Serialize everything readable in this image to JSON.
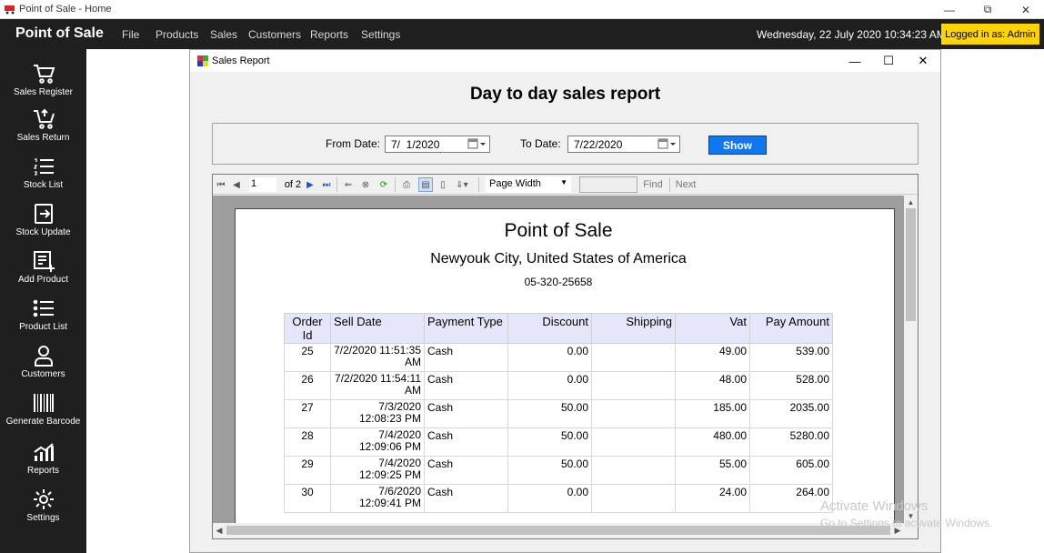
{
  "window": {
    "title": "Point of Sale - Home",
    "controls": {
      "minimize": "—",
      "restore": "⧉",
      "close": "✕"
    }
  },
  "menubar": {
    "brand": "Point of Sale",
    "items": [
      "File",
      "Products",
      "Sales",
      "Customers",
      "Reports",
      "Settings"
    ],
    "datetime": "Wednesday, 22 July 2020 10:34:23 AM",
    "login": "Logged in as: Admin"
  },
  "sidebar": {
    "items": [
      {
        "label": "Sales Register",
        "icon": "cart-icon"
      },
      {
        "label": "Sales Return",
        "icon": "cart-return-icon"
      },
      {
        "label": "Stock List",
        "icon": "numbered-list-icon"
      },
      {
        "label": "Stock Update",
        "icon": "exit-box-icon"
      },
      {
        "label": "Add Product",
        "icon": "add-document-icon"
      },
      {
        "label": "Product List",
        "icon": "bullet-list-icon"
      },
      {
        "label": "Customers",
        "icon": "person-icon"
      },
      {
        "label": "Generate Barcode",
        "icon": "barcode-icon"
      },
      {
        "label": "Reports",
        "icon": "chart-icon"
      },
      {
        "label": "Settings",
        "icon": "gear-icon"
      }
    ]
  },
  "sales_report": {
    "window_title": "Sales Report",
    "heading": "Day to day sales report",
    "from_label": "From Date:",
    "from_value": "7/  1/2020",
    "to_label": "To Date:",
    "to_value": "7/22/2020",
    "show_label": "Show"
  },
  "viewer": {
    "page_current": "1",
    "page_of": "of 2",
    "zoom": "Page Width",
    "find_label": "Find",
    "next_label": "Next"
  },
  "report": {
    "store_name": "Point of Sale",
    "address": "Newyouk City, United States of America",
    "phone": "05-320-25658",
    "columns": [
      "Order Id",
      "Sell Date",
      "Payment Type",
      "Discount",
      "Shipping",
      "Vat",
      "Pay Amount"
    ],
    "rows": [
      {
        "id": "25",
        "date": "7/2/2020 11:51:35 AM",
        "payment": "Cash",
        "discount": "0.00",
        "shipping": "",
        "vat": "49.00",
        "pay": "539.00"
      },
      {
        "id": "26",
        "date": "7/2/2020 11:54:11 AM",
        "payment": "Cash",
        "discount": "0.00",
        "shipping": "",
        "vat": "48.00",
        "pay": "528.00"
      },
      {
        "id": "27",
        "date": "7/3/2020 12:08:23 PM",
        "payment": "Cash",
        "discount": "50.00",
        "shipping": "",
        "vat": "185.00",
        "pay": "2035.00"
      },
      {
        "id": "28",
        "date": "7/4/2020 12:09:06 PM",
        "payment": "Cash",
        "discount": "50.00",
        "shipping": "",
        "vat": "480.00",
        "pay": "5280.00"
      },
      {
        "id": "29",
        "date": "7/4/2020 12:09:25 PM",
        "payment": "Cash",
        "discount": "50.00",
        "shipping": "",
        "vat": "55.00",
        "pay": "605.00"
      },
      {
        "id": "30",
        "date": "7/6/2020 12:09:41 PM",
        "payment": "Cash",
        "discount": "0.00",
        "shipping": "",
        "vat": "24.00",
        "pay": "264.00"
      }
    ]
  },
  "watermark": {
    "line1": "Activate Windows",
    "line2": "Go to Settings to activate Windows."
  },
  "colors": {
    "menubar_bg": "#1f1f1f",
    "login_badge": "#ffd400",
    "show_button": "#1177ee",
    "table_header": "#e6e6fa"
  }
}
